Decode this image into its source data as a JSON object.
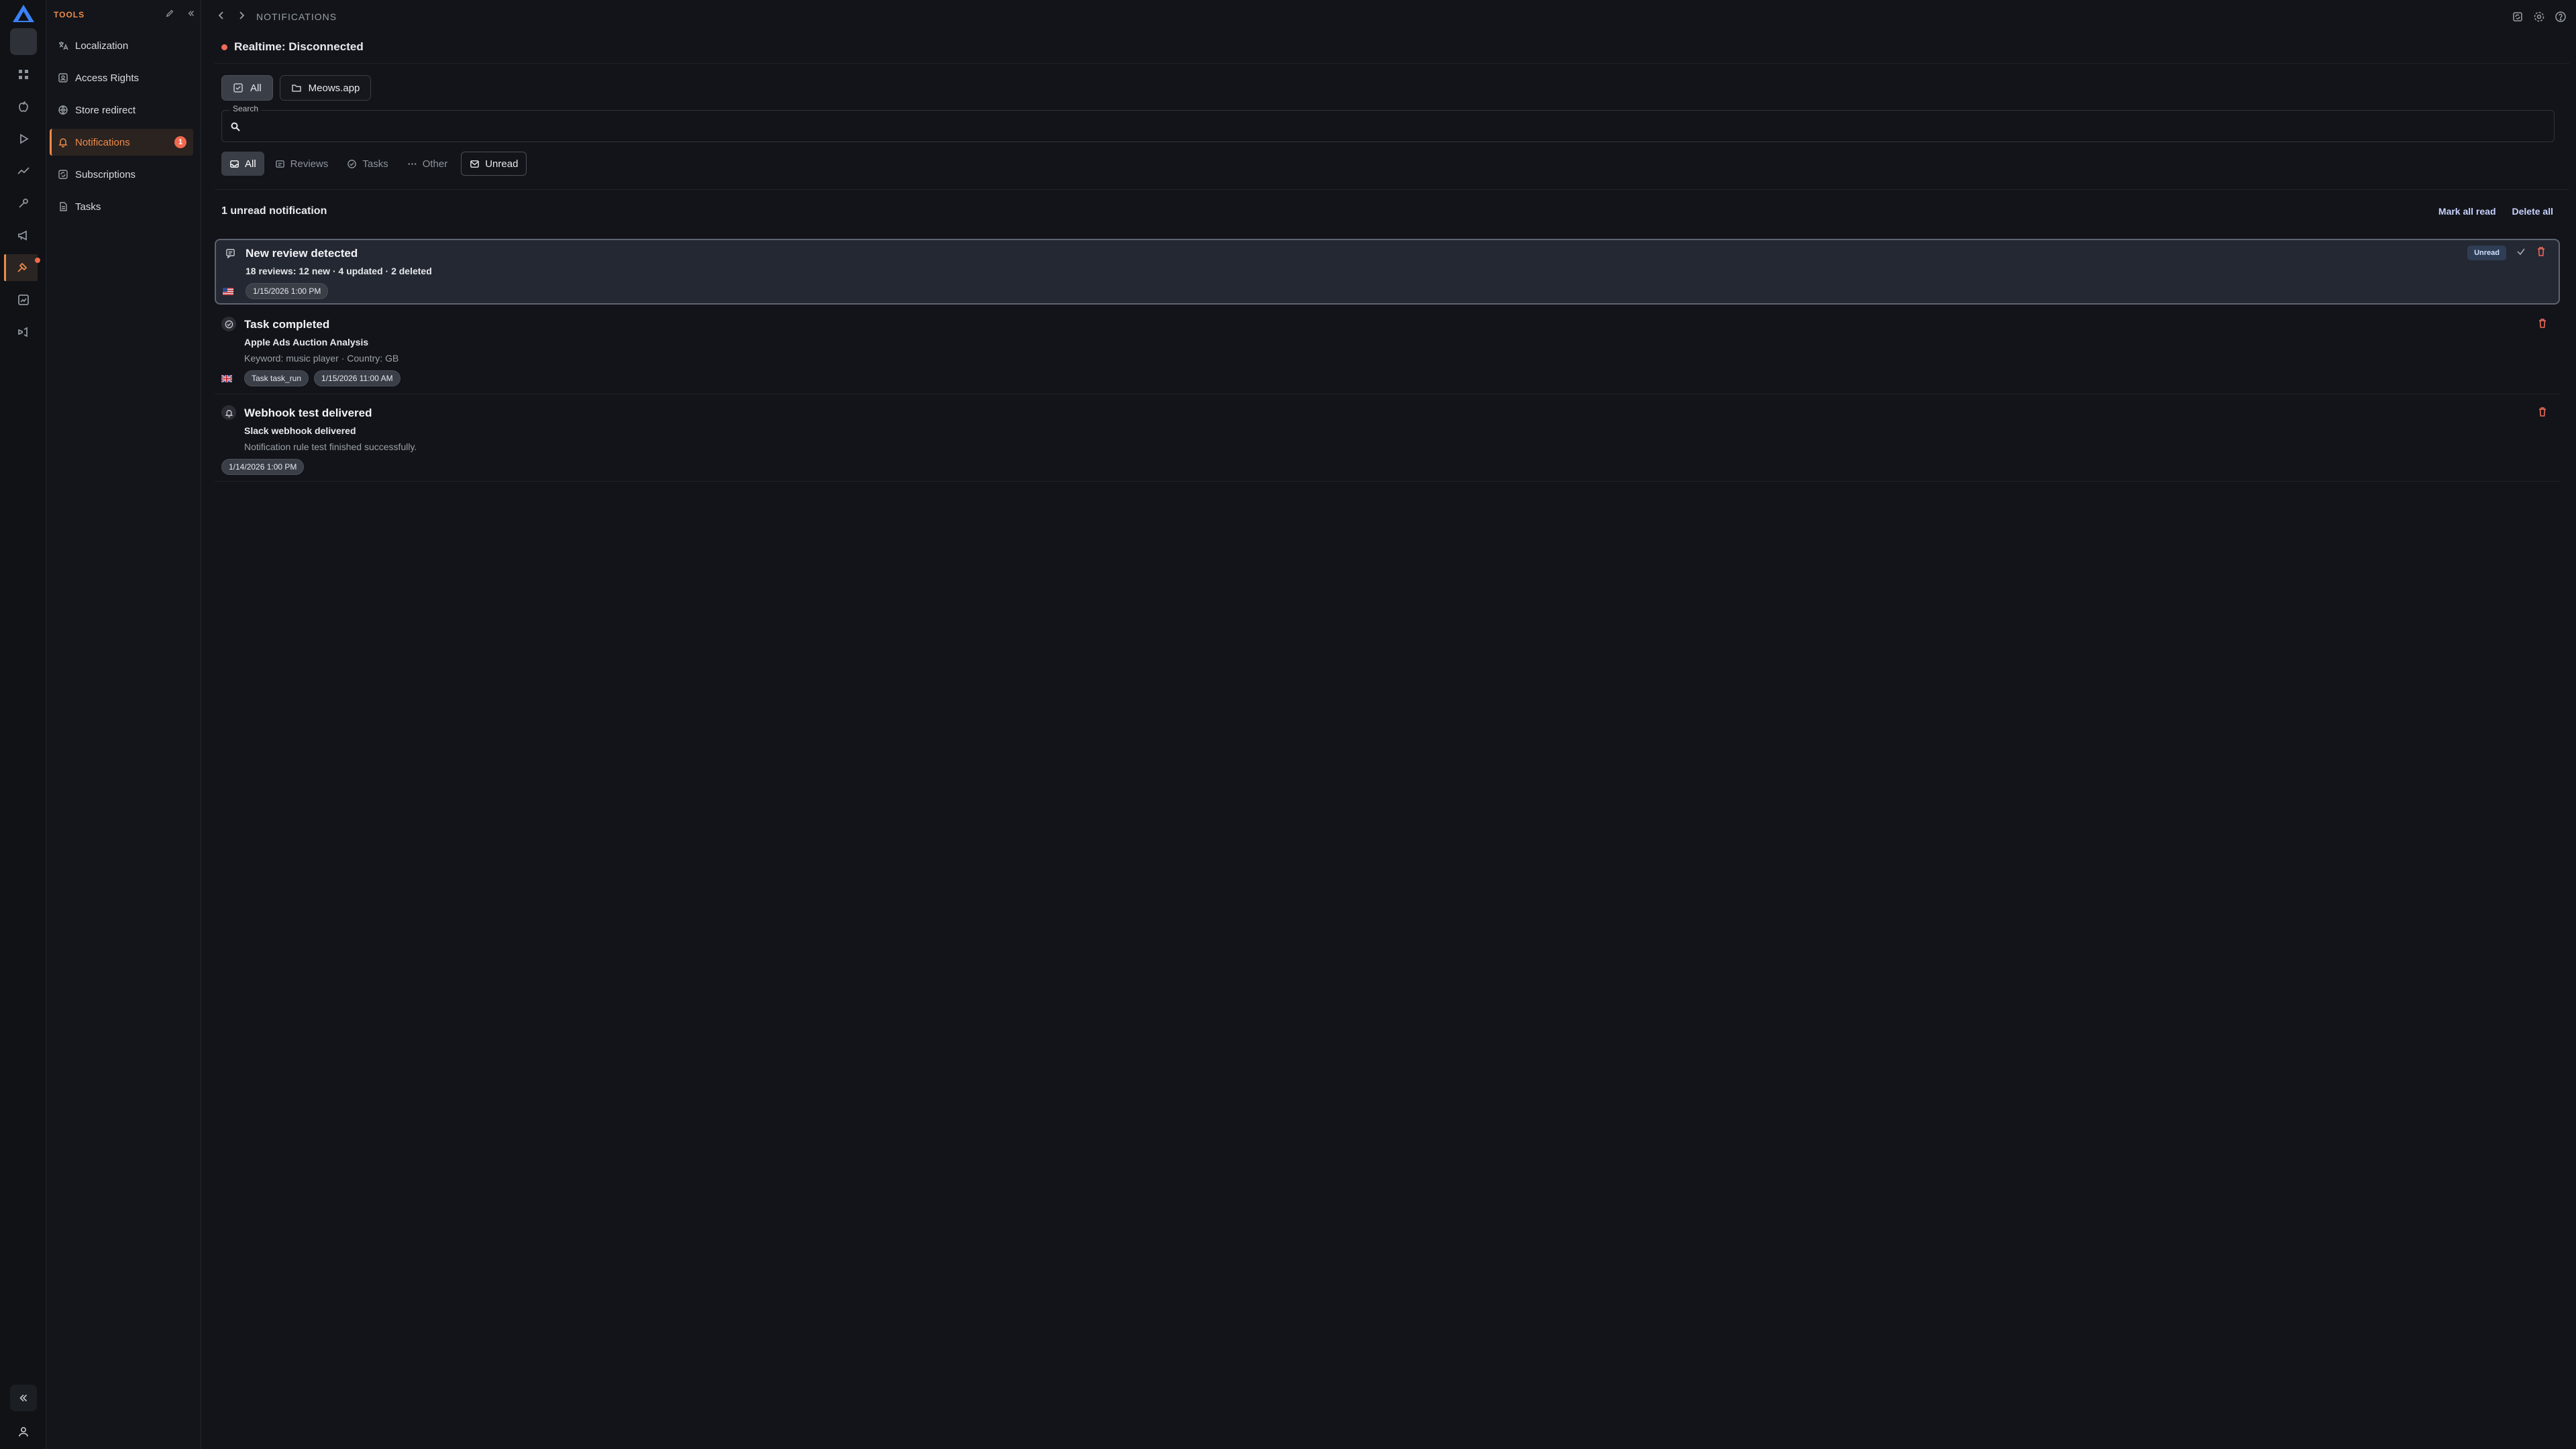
{
  "sidebar": {
    "title": "TOOLS",
    "items": [
      {
        "label": "Localization"
      },
      {
        "label": "Access Rights"
      },
      {
        "label": "Store redirect"
      },
      {
        "label": "Notifications",
        "badge": "1"
      },
      {
        "label": "Subscriptions"
      },
      {
        "label": "Tasks"
      }
    ]
  },
  "topbar": {
    "breadcrumb": "NOTIFICATIONS"
  },
  "realtime": {
    "status": "Realtime: Disconnected"
  },
  "scope_chips": [
    {
      "label": "All"
    },
    {
      "label": "Meows.app"
    }
  ],
  "search": {
    "label": "Search",
    "value": "",
    "placeholder": ""
  },
  "type_tabs": [
    {
      "label": "All"
    },
    {
      "label": "Reviews"
    },
    {
      "label": "Tasks"
    },
    {
      "label": "Other"
    },
    {
      "label": "Unread"
    }
  ],
  "summary": {
    "count_text": "1 unread notification",
    "mark_all_read": "Mark all read",
    "delete_all": "Delete all"
  },
  "notifications": [
    {
      "title": "New review detected",
      "subtitle": "18 reviews: 12 new · 4 updated · 2 deleted",
      "timestamp": "1/15/2026 1:00 PM",
      "badge": "Unread",
      "flag": "us-flag"
    },
    {
      "title": "Task completed",
      "subtitle": "Apple Ads Auction Analysis",
      "detail": "Keyword: music player · Country: GB",
      "tag": "Task task_run",
      "timestamp": "1/15/2026 11:00 AM",
      "flag": "gb-flag"
    },
    {
      "title": "Webhook test delivered",
      "subtitle": "Slack webhook delivered",
      "detail": "Notification rule test finished successfully.",
      "timestamp": "1/14/2026 1:00 PM"
    }
  ],
  "colors": {
    "accent": "#ef8a4a",
    "danger": "#f06a5a",
    "background": "#121419",
    "unread_card": "#242832"
  }
}
